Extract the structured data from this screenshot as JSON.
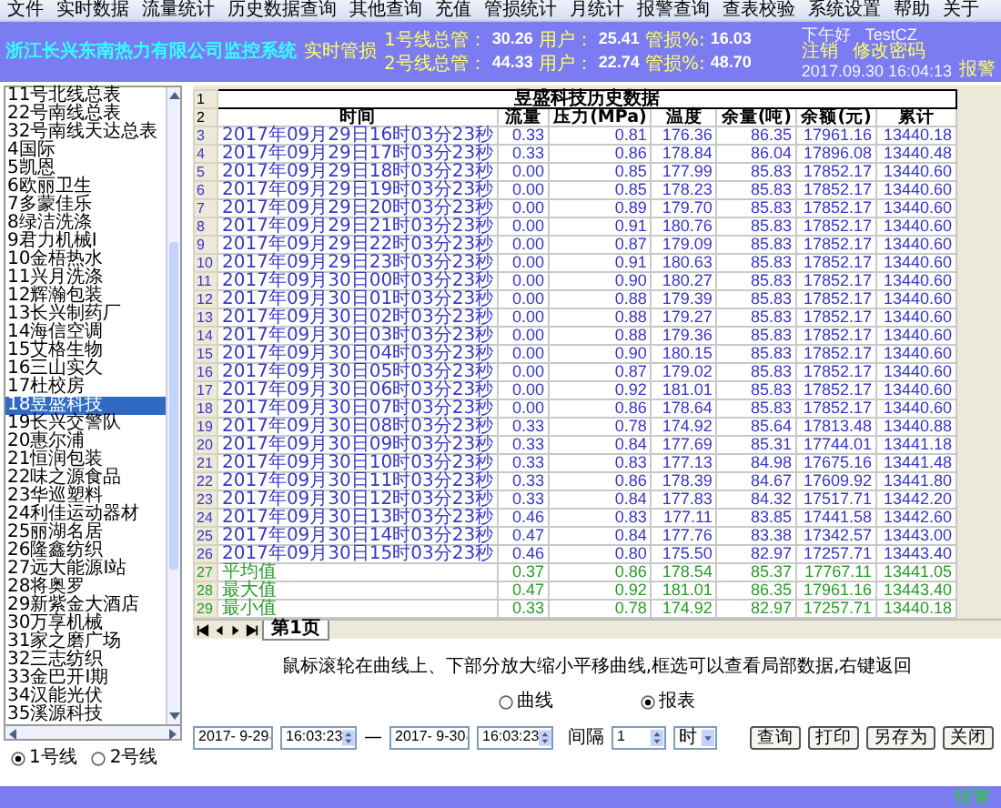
{
  "menu": [
    "文件",
    "实时数据",
    "流量统计",
    "历史数据查询",
    "其他查询",
    "充值",
    "管损统计",
    "月统计",
    "报警查询",
    "查表校验",
    "系统设置",
    "帮助",
    "关于"
  ],
  "header": {
    "title": "浙江长兴东南热力有限公司监控系统",
    "section_label": "实时管损",
    "lines": [
      {
        "label": "1号线总管：",
        "total": "30.26",
        "user_label": "用户：",
        "user": "25.41",
        "loss_label": "管损%:",
        "loss": "16.03"
      },
      {
        "label": "2号线总管：",
        "total": "44.33",
        "user_label": "用户：",
        "user": "22.74",
        "loss_label": "管损%:",
        "loss": "48.70"
      }
    ],
    "greeting": "下午好",
    "username": "TestCZ",
    "logout": "注销",
    "change_password": "修改密码",
    "datetime": "2017.09.30 16:04:13",
    "alarm": "报警"
  },
  "sidebar": {
    "items": [
      {
        "label": "11号北线总表",
        "selected": false
      },
      {
        "label": "22号南线总表",
        "selected": false
      },
      {
        "label": "32号南线天达总表",
        "selected": false
      },
      {
        "label": "4国际",
        "selected": false
      },
      {
        "label": "5凯恩",
        "selected": false
      },
      {
        "label": "6欧丽卫生",
        "selected": false
      },
      {
        "label": "7多蒙佳乐",
        "selected": false
      },
      {
        "label": "8绿洁洗涤",
        "selected": false
      },
      {
        "label": "9君力机械Ⅰ",
        "selected": false
      },
      {
        "label": "10金梧热水",
        "selected": false
      },
      {
        "label": "11兴月洗涤",
        "selected": false
      },
      {
        "label": "12辉瀚包装",
        "selected": false
      },
      {
        "label": "13长兴制药厂",
        "selected": false
      },
      {
        "label": "14海信空调",
        "selected": false
      },
      {
        "label": "15艾格生物",
        "selected": false
      },
      {
        "label": "16三山实久",
        "selected": false
      },
      {
        "label": "17杜校房",
        "selected": false
      },
      {
        "label": "18昱盛科技",
        "selected": true
      },
      {
        "label": "19长兴交警队",
        "selected": false
      },
      {
        "label": "20惠尔浦",
        "selected": false
      },
      {
        "label": "21恒润包装",
        "selected": false
      },
      {
        "label": "22味之源食品",
        "selected": false
      },
      {
        "label": "23华巡塑料",
        "selected": false
      },
      {
        "label": "24利佳运动器材",
        "selected": false
      },
      {
        "label": "25丽湖名居",
        "selected": false
      },
      {
        "label": "26隆鑫纺织",
        "selected": false
      },
      {
        "label": "27远大能源Ⅰ站",
        "selected": false
      },
      {
        "label": "28将奥罗",
        "selected": false
      },
      {
        "label": "29新紫金大酒店",
        "selected": false
      },
      {
        "label": "30万享机械",
        "selected": false
      },
      {
        "label": "31家之磨广场",
        "selected": false
      },
      {
        "label": "32三志纺织",
        "selected": false
      },
      {
        "label": "33金巴开Ⅰ期",
        "selected": false
      },
      {
        "label": "34汉能光伏",
        "selected": false
      },
      {
        "label": "35溪源科技",
        "selected": false
      }
    ]
  },
  "line_options": [
    {
      "label": "1号线",
      "selected": true
    },
    {
      "label": "2号线",
      "selected": false
    }
  ],
  "table": {
    "title_row_number": "1",
    "title": "昱盛科技历史数据",
    "columns_row_number": "2",
    "columns": [
      "时间",
      "流量",
      "压力(MPa)",
      "温度",
      "余量(吨)",
      "余额(元)",
      "累计"
    ],
    "rows": [
      {
        "number": "3",
        "kind": "data",
        "cells": [
          "2017年09月29日16时03分23秒",
          "0.33",
          "0.81",
          "176.36",
          "86.35",
          "17961.16",
          "13440.18"
        ]
      },
      {
        "number": "4",
        "kind": "data",
        "cells": [
          "2017年09月29日17时03分23秒",
          "0.33",
          "0.86",
          "178.84",
          "86.04",
          "17896.08",
          "13440.48"
        ]
      },
      {
        "number": "5",
        "kind": "data",
        "cells": [
          "2017年09月29日18时03分23秒",
          "0.00",
          "0.85",
          "177.99",
          "85.83",
          "17852.17",
          "13440.60"
        ]
      },
      {
        "number": "6",
        "kind": "data",
        "cells": [
          "2017年09月29日19时03分23秒",
          "0.00",
          "0.85",
          "178.23",
          "85.83",
          "17852.17",
          "13440.60"
        ]
      },
      {
        "number": "7",
        "kind": "data",
        "cells": [
          "2017年09月29日20时03分23秒",
          "0.00",
          "0.89",
          "179.70",
          "85.83",
          "17852.17",
          "13440.60"
        ]
      },
      {
        "number": "8",
        "kind": "data",
        "cells": [
          "2017年09月29日21时03分23秒",
          "0.00",
          "0.91",
          "180.76",
          "85.83",
          "17852.17",
          "13440.60"
        ]
      },
      {
        "number": "9",
        "kind": "data",
        "cells": [
          "2017年09月29日22时03分23秒",
          "0.00",
          "0.87",
          "179.09",
          "85.83",
          "17852.17",
          "13440.60"
        ]
      },
      {
        "number": "10",
        "kind": "data",
        "cells": [
          "2017年09月29日23时03分23秒",
          "0.00",
          "0.91",
          "180.63",
          "85.83",
          "17852.17",
          "13440.60"
        ]
      },
      {
        "number": "11",
        "kind": "data",
        "cells": [
          "2017年09月30日00时03分23秒",
          "0.00",
          "0.90",
          "180.27",
          "85.83",
          "17852.17",
          "13440.60"
        ]
      },
      {
        "number": "12",
        "kind": "data",
        "cells": [
          "2017年09月30日01时03分23秒",
          "0.00",
          "0.88",
          "179.39",
          "85.83",
          "17852.17",
          "13440.60"
        ]
      },
      {
        "number": "13",
        "kind": "data",
        "cells": [
          "2017年09月30日02时03分23秒",
          "0.00",
          "0.88",
          "179.27",
          "85.83",
          "17852.17",
          "13440.60"
        ]
      },
      {
        "number": "14",
        "kind": "data",
        "cells": [
          "2017年09月30日03时03分23秒",
          "0.00",
          "0.88",
          "179.36",
          "85.83",
          "17852.17",
          "13440.60"
        ]
      },
      {
        "number": "15",
        "kind": "data",
        "cells": [
          "2017年09月30日04时03分23秒",
          "0.00",
          "0.90",
          "180.15",
          "85.83",
          "17852.17",
          "13440.60"
        ]
      },
      {
        "number": "16",
        "kind": "data",
        "cells": [
          "2017年09月30日05时03分23秒",
          "0.00",
          "0.87",
          "179.02",
          "85.83",
          "17852.17",
          "13440.60"
        ]
      },
      {
        "number": "17",
        "kind": "data",
        "cells": [
          "2017年09月30日06时03分23秒",
          "0.00",
          "0.92",
          "181.01",
          "85.83",
          "17852.17",
          "13440.60"
        ]
      },
      {
        "number": "18",
        "kind": "data",
        "cells": [
          "2017年09月30日07时03分23秒",
          "0.00",
          "0.86",
          "178.64",
          "85.83",
          "17852.17",
          "13440.60"
        ]
      },
      {
        "number": "19",
        "kind": "data",
        "cells": [
          "2017年09月30日08时03分23秒",
          "0.33",
          "0.78",
          "174.92",
          "85.64",
          "17813.48",
          "13440.88"
        ]
      },
      {
        "number": "20",
        "kind": "data",
        "cells": [
          "2017年09月30日09时03分23秒",
          "0.33",
          "0.84",
          "177.69",
          "85.31",
          "17744.01",
          "13441.18"
        ]
      },
      {
        "number": "21",
        "kind": "data",
        "cells": [
          "2017年09月30日10时03分23秒",
          "0.33",
          "0.83",
          "177.13",
          "84.98",
          "17675.16",
          "13441.48"
        ]
      },
      {
        "number": "22",
        "kind": "data",
        "cells": [
          "2017年09月30日11时03分23秒",
          "0.33",
          "0.86",
          "178.39",
          "84.67",
          "17609.92",
          "13441.80"
        ]
      },
      {
        "number": "23",
        "kind": "data",
        "cells": [
          "2017年09月30日12时03分23秒",
          "0.33",
          "0.84",
          "177.83",
          "84.32",
          "17517.71",
          "13442.20"
        ]
      },
      {
        "number": "24",
        "kind": "data",
        "cells": [
          "2017年09月30日13时03分23秒",
          "0.46",
          "0.83",
          "177.11",
          "83.85",
          "17441.58",
          "13442.60"
        ]
      },
      {
        "number": "25",
        "kind": "data",
        "cells": [
          "2017年09月30日14时03分23秒",
          "0.47",
          "0.84",
          "177.76",
          "83.38",
          "17342.57",
          "13443.00"
        ]
      },
      {
        "number": "26",
        "kind": "data",
        "cells": [
          "2017年09月30日15时03分23秒",
          "0.46",
          "0.80",
          "175.50",
          "82.97",
          "17257.71",
          "13443.40"
        ]
      },
      {
        "number": "27",
        "kind": "summary",
        "cells": [
          "平均值",
          "0.37",
          "0.86",
          "178.54",
          "85.37",
          "17767.11",
          "13441.05"
        ]
      },
      {
        "number": "28",
        "kind": "summary",
        "cells": [
          "最大值",
          "0.47",
          "0.92",
          "181.01",
          "86.35",
          "17961.16",
          "13443.40"
        ]
      },
      {
        "number": "29",
        "kind": "summary",
        "cells": [
          "最小值",
          "0.33",
          "0.78",
          "174.92",
          "82.97",
          "17257.71",
          "13440.18"
        ]
      }
    ]
  },
  "sheet_tabs": [
    {
      "label": "第1页",
      "selected": true
    }
  ],
  "hint": "鼠标滚轮在曲线上、下部分放大缩小平移曲线,框选可以查看局部数据,右键返回",
  "view_options": [
    {
      "label": "曲线",
      "selected": false
    },
    {
      "label": "报表",
      "selected": true
    }
  ],
  "query": {
    "start_date": "2017- 9-29",
    "start_time": "16:03:23",
    "separator": "—",
    "end_date": "2017- 9-30",
    "end_time": "16:03:23",
    "interval_label": "间隔",
    "interval": "1",
    "unit": "时"
  },
  "buttons": [
    "查询",
    "打印",
    "另存为",
    "关闭"
  ],
  "status_bar": {
    "alarm": "报警"
  }
}
